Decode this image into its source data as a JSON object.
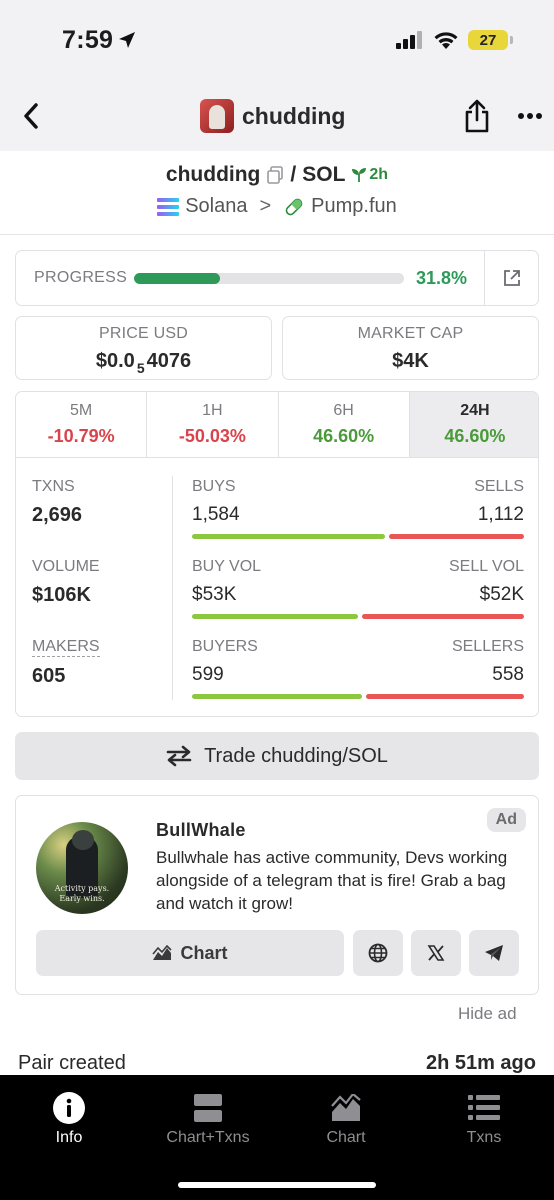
{
  "status_bar": {
    "time": "7:59",
    "battery": "27"
  },
  "nav": {
    "title": "chudding"
  },
  "pair": {
    "base": "chudding",
    "separator": "/",
    "quote": "SOL",
    "age": "2h",
    "chain": "Solana",
    "chevron": ">",
    "dex": "Pump.fun"
  },
  "progress": {
    "label": "PROGRESS",
    "value": "31.8%",
    "fraction": 0.318
  },
  "price": {
    "label": "PRICE USD",
    "prefix": "$0.0",
    "zeros": "5",
    "digits": "4076"
  },
  "market_cap": {
    "label": "MARKET CAP",
    "value": "$4K"
  },
  "timeframes": [
    {
      "label": "5M",
      "change": "-10.79%",
      "direction": "neg"
    },
    {
      "label": "1H",
      "change": "-50.03%",
      "direction": "neg"
    },
    {
      "label": "6H",
      "change": "46.60%",
      "direction": "pos"
    },
    {
      "label": "24H",
      "change": "46.60%",
      "direction": "pos",
      "active": true
    }
  ],
  "metrics": {
    "txns": {
      "label": "TXNS",
      "value": "2,696"
    },
    "volume": {
      "label": "VOLUME",
      "value": "$106K"
    },
    "makers": {
      "label": "MAKERS",
      "value": "605"
    }
  },
  "splits": {
    "txns": {
      "left_label": "BUYS",
      "right_label": "SELLS",
      "left_value": "1,584",
      "right_value": "1,112",
      "left_ratio": 0.588
    },
    "volume": {
      "left_label": "BUY VOL",
      "right_label": "SELL VOL",
      "left_value": "$53K",
      "right_value": "$52K",
      "left_ratio": 0.505
    },
    "makers": {
      "left_label": "BUYERS",
      "right_label": "SELLERS",
      "left_value": "599",
      "right_value": "558",
      "left_ratio": 0.518
    }
  },
  "trade_button": "Trade chudding/SOL",
  "ad": {
    "badge": "Ad",
    "title": "BullWhale",
    "body": "Bullwhale has active community, Devs working alongside of a telegram that is fire! Grab a bag and watch it grow!",
    "image_text_line1": "Activity pays.",
    "image_text_line2": "Early wins.",
    "chart_button": "Chart",
    "hide": "Hide ad"
  },
  "pair_created": {
    "label": "Pair created",
    "value": "2h 51m ago"
  },
  "tab_bar": [
    {
      "label": "Info",
      "icon": "info-icon",
      "active": true
    },
    {
      "label": "Chart+Txns",
      "icon": "split-view-icon"
    },
    {
      "label": "Chart",
      "icon": "area-chart-icon"
    },
    {
      "label": "Txns",
      "icon": "list-icon"
    }
  ],
  "colors": {
    "positive": "#4a9a3a",
    "negative": "#d9434b",
    "progress": "#2e9a5a",
    "buy_bar": "#8dc63f",
    "sell_bar": "#e85656"
  }
}
